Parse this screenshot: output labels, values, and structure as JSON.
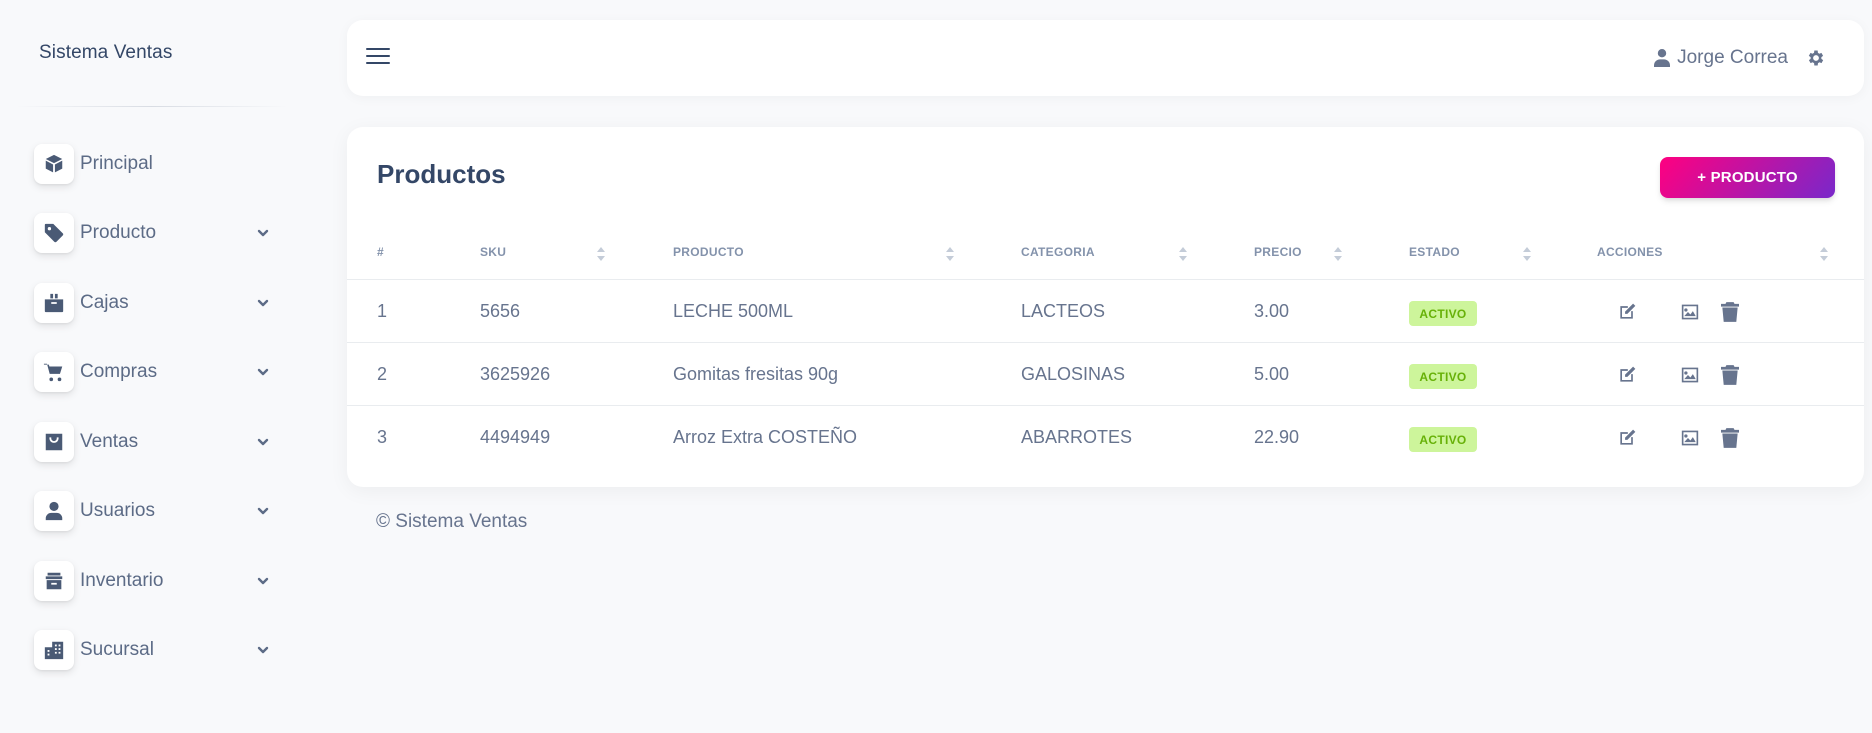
{
  "sidebar": {
    "brand": "Sistema Ventas",
    "items": [
      {
        "label": "Principal",
        "icon": "cube-icon",
        "has_submenu": false
      },
      {
        "label": "Producto",
        "icon": "tag-icon",
        "has_submenu": true
      },
      {
        "label": "Cajas",
        "icon": "cash-box-icon",
        "has_submenu": true
      },
      {
        "label": "Compras",
        "icon": "cart-icon",
        "has_submenu": true
      },
      {
        "label": "Ventas",
        "icon": "shopping-bag-icon",
        "has_submenu": true
      },
      {
        "label": "Usuarios",
        "icon": "user-icon",
        "has_submenu": true
      },
      {
        "label": "Inventario",
        "icon": "archive-icon",
        "has_submenu": true
      },
      {
        "label": "Sucursal",
        "icon": "building-icon",
        "has_submenu": true
      }
    ]
  },
  "topbar": {
    "menu_icon": "hamburger-icon",
    "user_name": "Jorge Correa",
    "user_icon": "user-icon",
    "settings_icon": "gear-icon"
  },
  "products": {
    "title": "Productos",
    "add_button_label": "+ PRODUCTO",
    "columns": [
      "#",
      "SKU",
      "PRODUCTO",
      "CATEGORIA",
      "PRECIO",
      "ESTADO",
      "ACCIONES"
    ],
    "rows": [
      {
        "num": "1",
        "sku": "5656",
        "product": "LECHE 500ML",
        "category": "LACTEOS",
        "price": "3.00",
        "status": "ACTIVO"
      },
      {
        "num": "2",
        "sku": "3625926",
        "product": "Gomitas fresitas 90g",
        "category": "GALOSINAS",
        "price": "5.00",
        "status": "ACTIVO"
      },
      {
        "num": "3",
        "sku": "4494949",
        "product": "Arroz Extra COSTEÑO",
        "category": "ABARROTES",
        "price": "22.90",
        "status": "ACTIVO"
      }
    ],
    "action_icons": [
      "edit-icon",
      "image-icon",
      "trash-icon"
    ]
  },
  "footer": {
    "text": "© Sistema Ventas"
  },
  "colors": {
    "accent_gradient_start": "#ff0080",
    "accent_gradient_end": "#7928ca",
    "status_active_bg": "#cdf59b",
    "status_active_text": "#67b108"
  }
}
